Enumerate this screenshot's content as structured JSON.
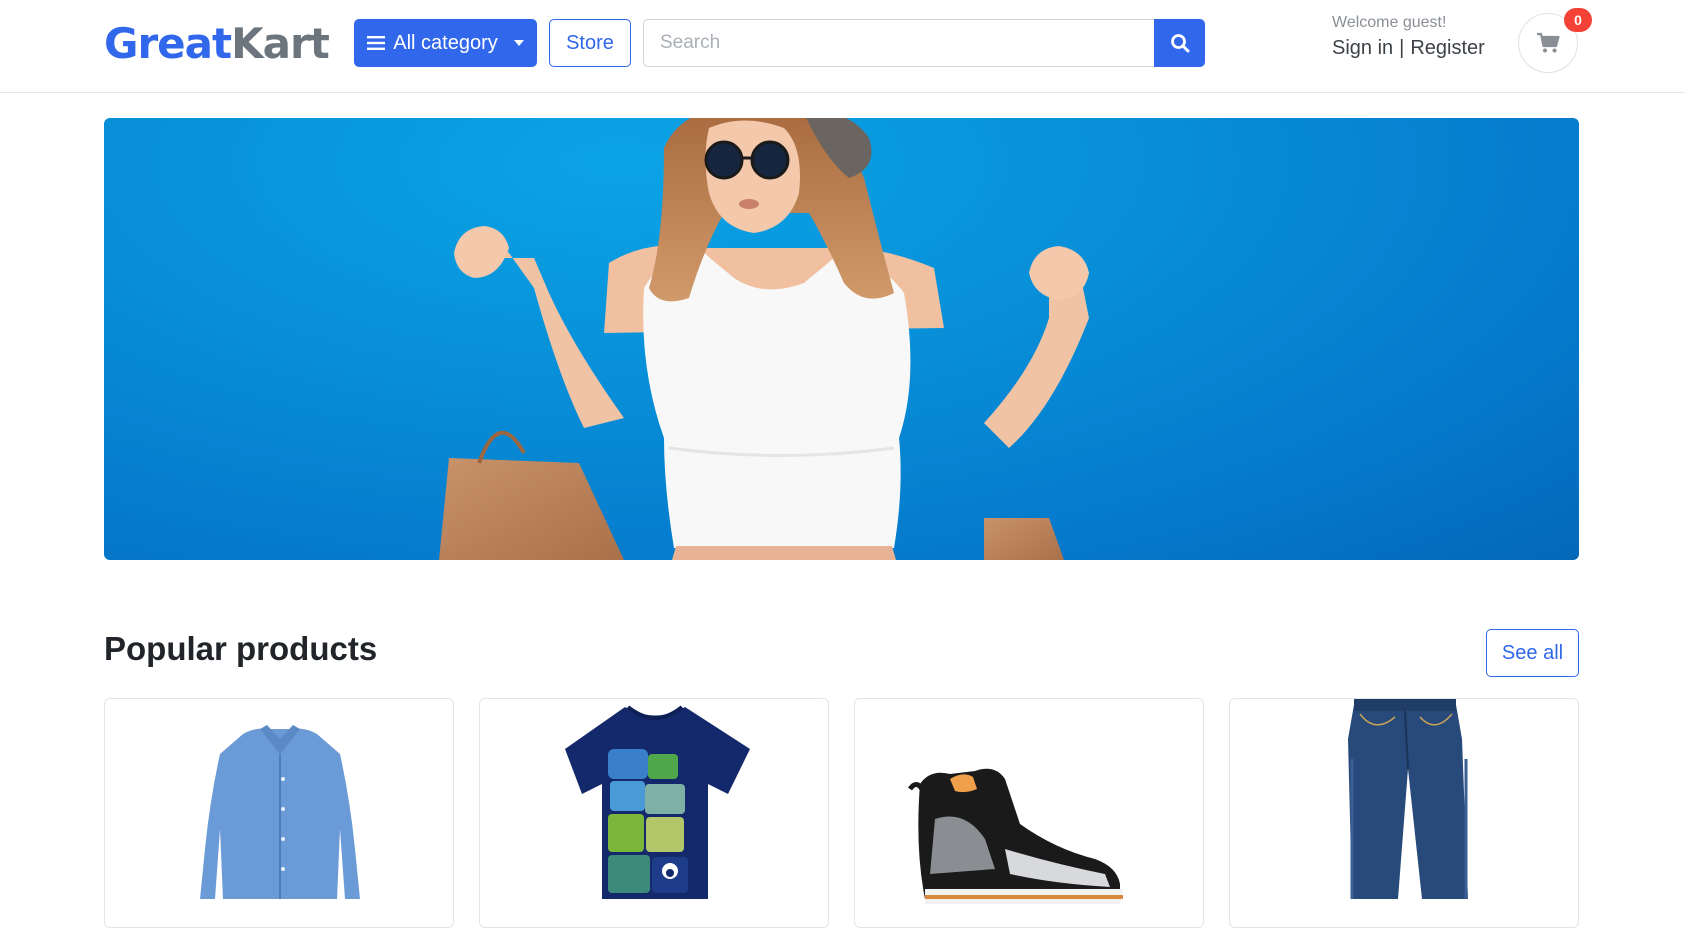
{
  "brand": {
    "name_part1": "Great",
    "name_part2": "Kart",
    "color_primary": "#3167eb",
    "color_secondary": "#6c757d"
  },
  "header": {
    "category_label": "All category",
    "store_label": "Store",
    "search_placeholder": "Search",
    "welcome_text": "Welcome guest!",
    "signin_label": "Sign in",
    "separator": "|",
    "register_label": "Register",
    "cart_count": "0"
  },
  "banner": {
    "image_description": "woman-with-shopping-bags",
    "background_color": "#0891d9"
  },
  "popular": {
    "title": "Popular products",
    "see_all_label": "See all",
    "products": [
      {
        "icon": "shirt-icon"
      },
      {
        "icon": "tshirt-icon"
      },
      {
        "icon": "sneaker-icon"
      },
      {
        "icon": "jeans-icon"
      }
    ]
  },
  "colors": {
    "accent": "#3167eb",
    "badge": "#f44336",
    "border": "#e5e7eb"
  }
}
